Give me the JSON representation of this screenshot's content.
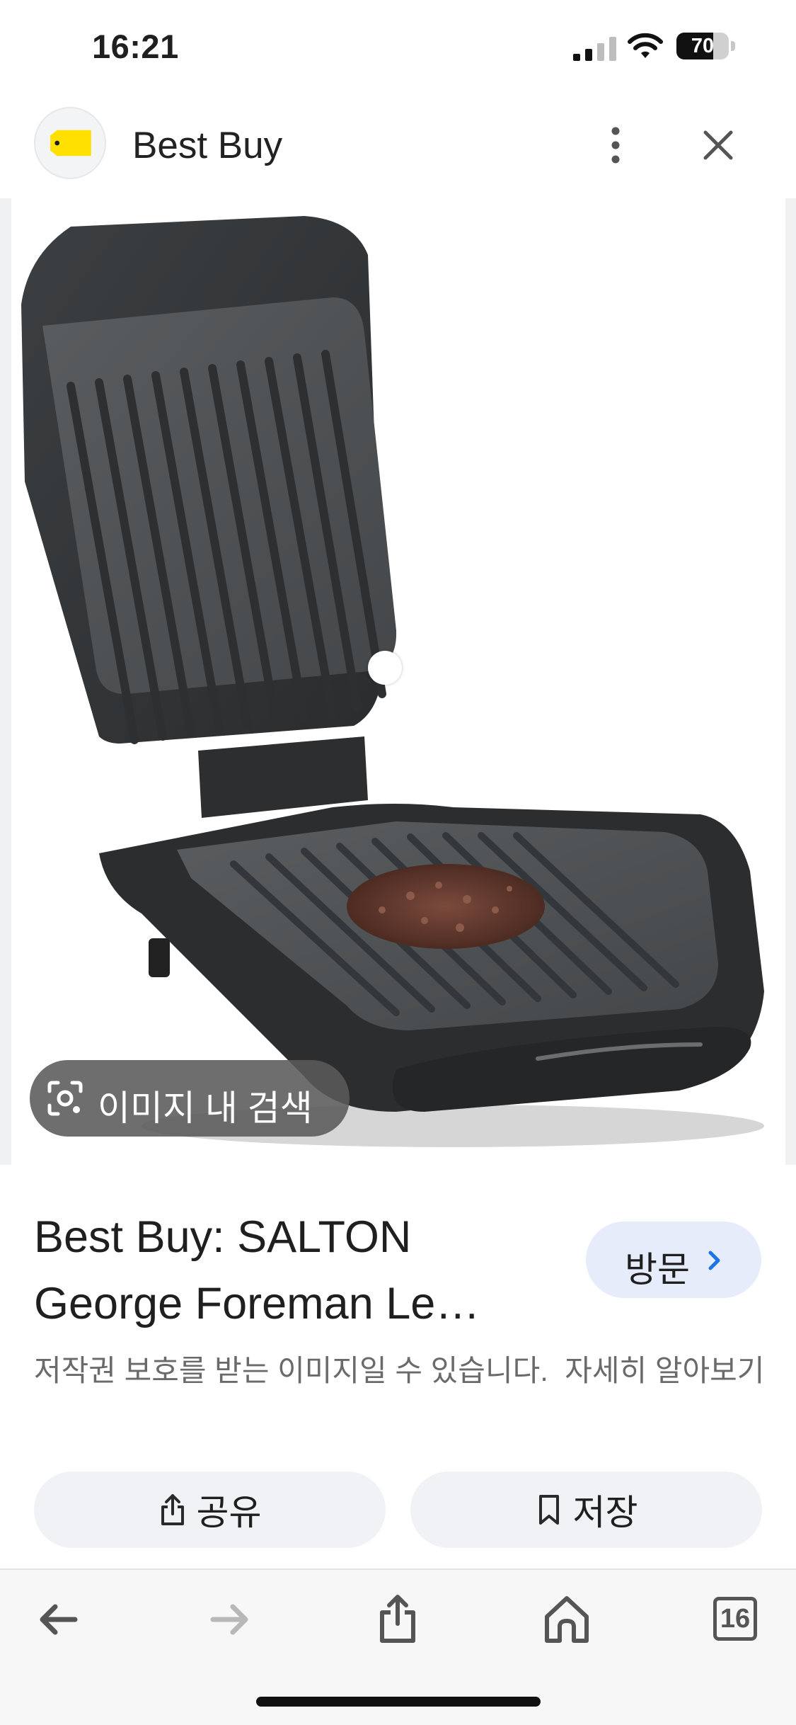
{
  "status_bar": {
    "time": "16:21",
    "battery_level": "70",
    "icons": [
      "cellular-signal-icon",
      "wifi-icon",
      "battery-icon"
    ]
  },
  "header": {
    "site_name": "Best Buy",
    "logo_icon": "best-buy-tag-logo",
    "logo_color": "#FFE000",
    "more_icon": "more-vertical-icon",
    "close_icon": "close-icon"
  },
  "image": {
    "subject": "George Foreman grill",
    "lens_label": "이미지 내 검색",
    "lens_icon": "camera-lens-icon"
  },
  "result": {
    "title_line1": "Best Buy: SALTON",
    "title_line2": "George Foreman Le…",
    "visit_label": "방문",
    "visit_icon": "chevron-right-icon",
    "accent_color": "#1A73E8",
    "copyright_text": "저작권 보호를 받는 이미지일 수 있습니다.",
    "learn_more": "자세히 알아보기"
  },
  "actions": {
    "share_label": "공유",
    "share_icon": "share-icon",
    "save_label": "저장",
    "save_icon": "bookmark-icon"
  },
  "toolbar": {
    "tabs_count": "16",
    "icons": [
      "back-arrow-icon",
      "forward-arrow-icon",
      "share-icon",
      "home-icon",
      "tabs-icon"
    ]
  }
}
